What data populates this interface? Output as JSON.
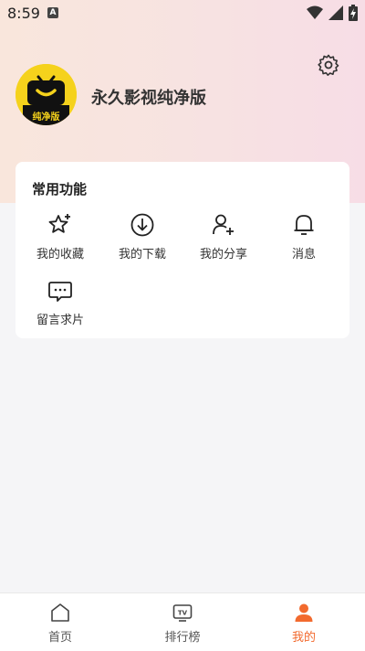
{
  "status_bar": {
    "time": "8:59",
    "notification_letter": "A"
  },
  "profile": {
    "app_name": "永久影视纯净版",
    "avatar_caption": "纯净版"
  },
  "functions": {
    "title": "常用功能",
    "items": [
      {
        "label": "我的收藏",
        "icon": "star-add-icon"
      },
      {
        "label": "我的下载",
        "icon": "download-icon"
      },
      {
        "label": "我的分享",
        "icon": "user-add-icon"
      },
      {
        "label": "消息",
        "icon": "bell-icon"
      },
      {
        "label": "留言求片",
        "icon": "message-icon"
      }
    ]
  },
  "tabbar": {
    "active_color": "#f26a2e",
    "items": [
      {
        "label": "首页",
        "icon": "home-icon"
      },
      {
        "label": "排行榜",
        "icon": "tv-icon"
      },
      {
        "label": "我的",
        "icon": "user-icon",
        "active": true
      }
    ]
  }
}
